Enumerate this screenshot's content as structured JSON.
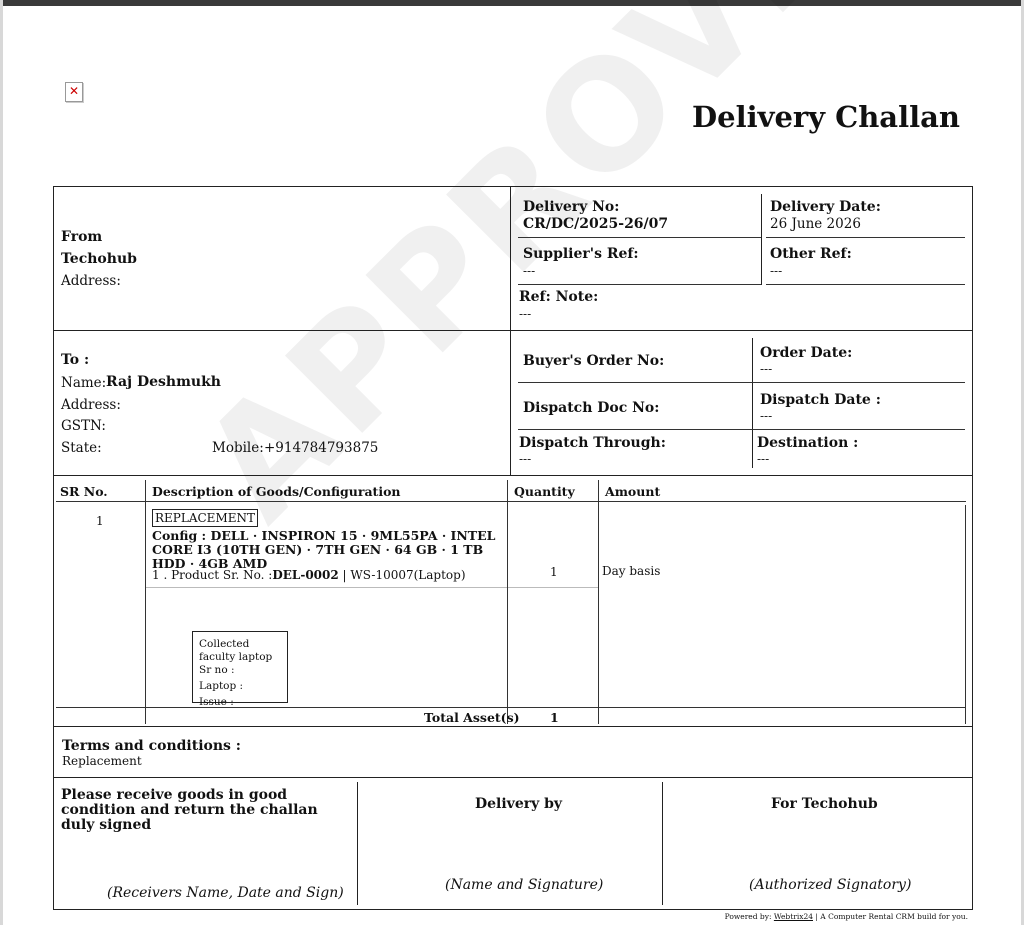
{
  "document": {
    "title": "Delivery Challan",
    "watermark": "APPROVED"
  },
  "from": {
    "heading": "From",
    "company": "Techohub",
    "address_label": "Address:"
  },
  "meta": {
    "delivery_no_label": "Delivery No:",
    "delivery_no": "CR/DC/2025-26/07",
    "delivery_date_label": "Delivery Date:",
    "delivery_date": "26 June 2026",
    "suppliers_ref_label": "Supplier's Ref:",
    "suppliers_ref": "---",
    "other_ref_label": "Other Ref:",
    "other_ref": "---",
    "ref_note_label": "Ref: Note:",
    "ref_note": "---"
  },
  "to": {
    "heading": "To :",
    "name_label": "Name:",
    "name": "Raj Deshmukh",
    "address_label": "Address:",
    "gstn_label": "GSTN:",
    "state_label": "State:",
    "mobile_label": "Mobile:",
    "mobile": "+914784793875"
  },
  "order": {
    "buyers_order_label": "Buyer's Order No:",
    "order_date_label": "Order Date:",
    "order_date": "---",
    "dispatch_doc_label": "Dispatch Doc No:",
    "dispatch_date_label": "Dispatch Date :",
    "dispatch_date": "---",
    "dispatch_through_label": "Dispatch Through:",
    "dispatch_through": "---",
    "destination_label": "Destination :",
    "destination": "---"
  },
  "items_table": {
    "columns": [
      "SR No.",
      "Description of Goods/Configuration",
      "Quantity",
      "Amount"
    ],
    "rows": [
      {
        "sr": "1",
        "tag": "REPLACEMENT",
        "config": "Config : DELL · INSPIRON 15 · 9ML55PA · INTEL CORE I3 (10TH GEN) · 7TH GEN · 64 GB · 1 TB HDD · 4GB AMD",
        "product_prefix": "1 . Product Sr. No. :",
        "product_serial": "DEL-0002",
        "product_suffix": " | WS-10007(Laptop)",
        "quantity": "1",
        "amount": "Day basis"
      }
    ],
    "collected": {
      "line1": "Collected faculty laptop Sr no :",
      "line2": "Laptop :",
      "line3": "Issue :"
    },
    "total_label": "Total Asset(s)",
    "total_value": "1"
  },
  "terms": {
    "heading": "Terms and conditions :",
    "text": "Replacement"
  },
  "signatures": {
    "receive_text": "Please receive goods in good condition and return the challan duly signed",
    "receiver_sign": "(Receivers Name, Date and Sign)",
    "delivery_by": "Delivery by",
    "delivery_sign": "(Name and Signature)",
    "for_company": "For Techohub",
    "authorized_sign": "(Authorized Signatory)"
  },
  "footer": {
    "prefix": "Powered by:",
    "link": "Webtrix24",
    "suffix": " | A Computer Rental CRM build for you."
  }
}
